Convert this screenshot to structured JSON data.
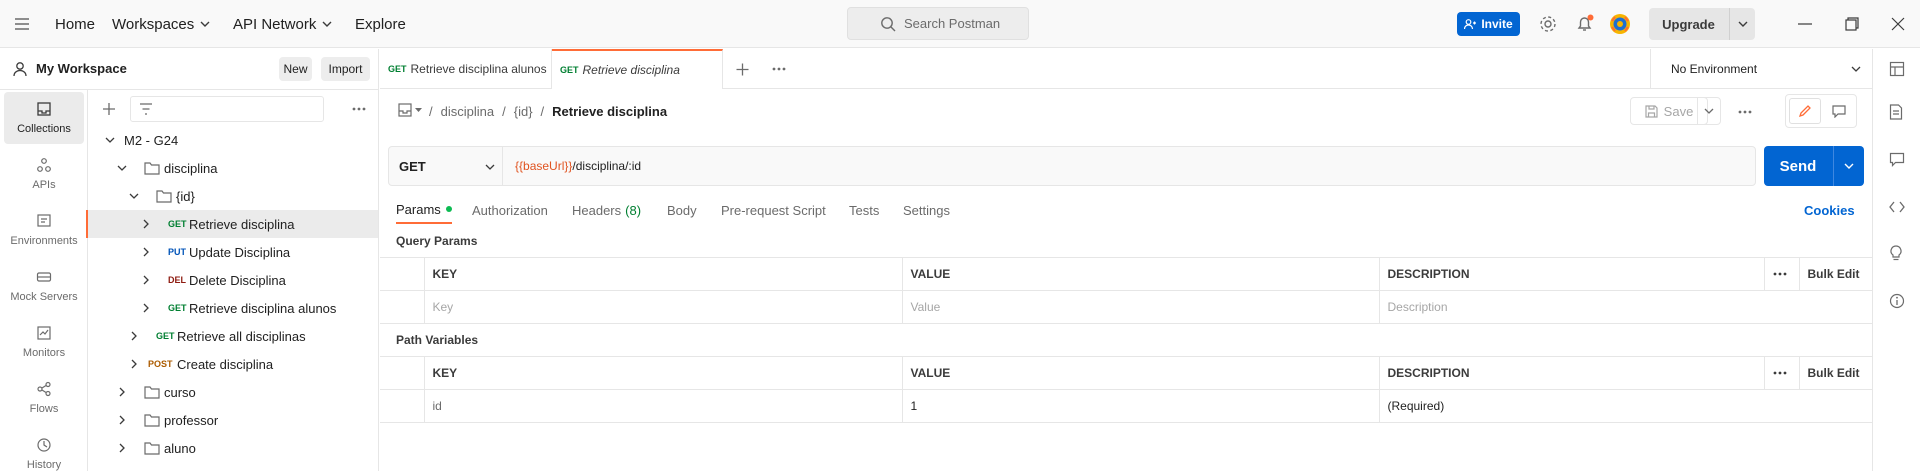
{
  "header": {
    "nav": [
      "Home",
      "Workspaces",
      "API Network",
      "Explore"
    ],
    "search_placeholder": "Search Postman",
    "invite_label": "Invite",
    "upgrade_label": "Upgrade"
  },
  "workspace": {
    "name": "My Workspace",
    "new_label": "New",
    "import_label": "Import"
  },
  "rail": [
    "Collections",
    "APIs",
    "Environments",
    "Mock Servers",
    "Monitors",
    "Flows",
    "History"
  ],
  "tree": [
    {
      "label": "M2 - G24",
      "type": "collection"
    },
    {
      "label": "disciplina",
      "type": "folder"
    },
    {
      "label": "{id}",
      "type": "folder"
    },
    {
      "method": "GET",
      "label": "Retrieve disciplina"
    },
    {
      "method": "PUT",
      "label": "Update Disciplina"
    },
    {
      "method": "DEL",
      "label": "Delete Disciplina"
    },
    {
      "method": "GET",
      "label": "Retrieve disciplina alunos"
    },
    {
      "method": "GET",
      "label": "Retrieve all disciplinas"
    },
    {
      "method": "POST",
      "label": "Create disciplina"
    },
    {
      "label": "curso",
      "type": "folder"
    },
    {
      "label": "professor",
      "type": "folder"
    },
    {
      "label": "aluno",
      "type": "folder"
    }
  ],
  "tabs": [
    {
      "method": "GET",
      "label": "Retrieve disciplina alunos"
    },
    {
      "method": "GET",
      "label": "Retrieve disciplina"
    }
  ],
  "environment": "No Environment",
  "breadcrumb": {
    "sep": "/",
    "parts": [
      "disciplina",
      "{id}"
    ],
    "current": "Retrieve disciplina"
  },
  "save_label": "Save",
  "request": {
    "method": "GET",
    "url_var": "{{baseUrl}}",
    "url_rest": "/disciplina/:id",
    "send_label": "Send"
  },
  "req_tabs": {
    "params": "Params",
    "authorization": "Authorization",
    "headers": "Headers",
    "headers_count": "(8)",
    "body": "Body",
    "pre_request": "Pre-request Script",
    "tests": "Tests",
    "settings": "Settings",
    "cookies": "Cookies"
  },
  "query_params": {
    "title": "Query Params",
    "columns": [
      "KEY",
      "VALUE",
      "DESCRIPTION"
    ],
    "bulk_edit": "Bulk Edit",
    "placeholders": [
      "Key",
      "Value",
      "Description"
    ]
  },
  "path_variables": {
    "title": "Path Variables",
    "columns": [
      "KEY",
      "VALUE",
      "DESCRIPTION"
    ],
    "bulk_edit": "Bulk Edit",
    "rows": [
      {
        "key": "id",
        "value": "1",
        "description": "(Required)"
      }
    ]
  },
  "colors": {
    "accent": "#ff6c37",
    "primary": "#0265d2",
    "get": "#007f31",
    "put": "#0053b8",
    "delete": "#8e1a10",
    "post": "#ab5b00",
    "url_var": "#e05320"
  }
}
